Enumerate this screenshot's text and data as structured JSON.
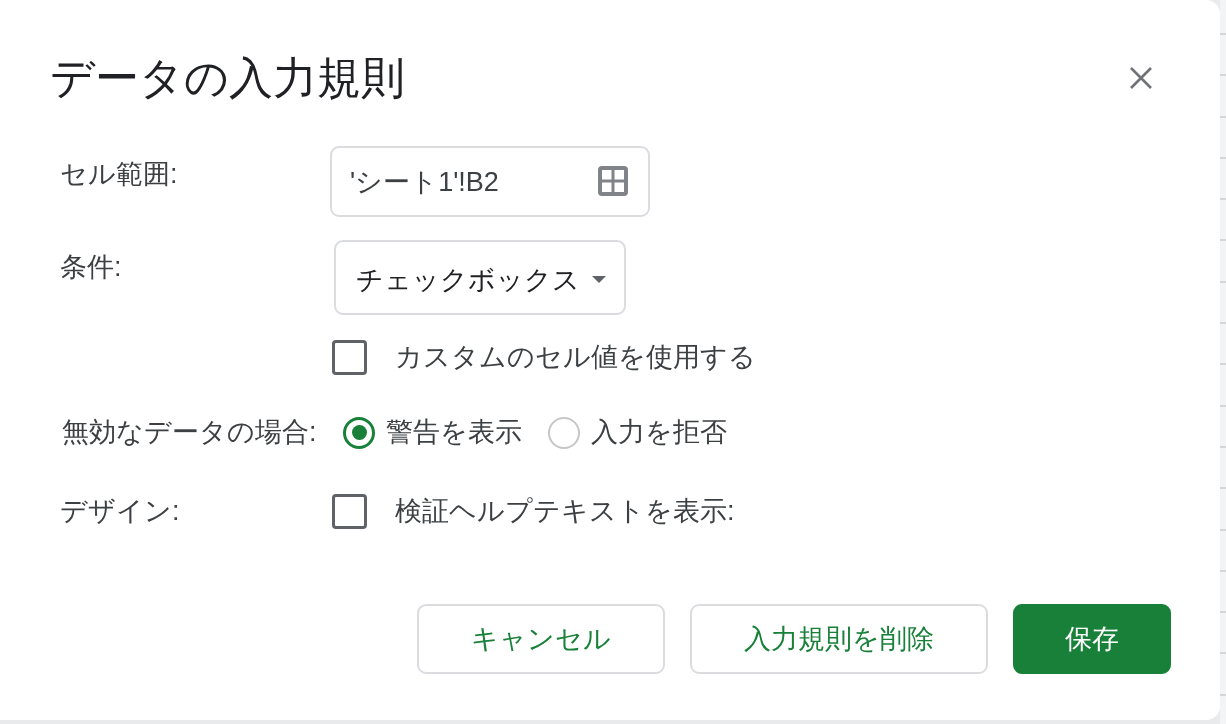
{
  "dialog": {
    "title": "データの入力規則",
    "cell_range": {
      "label": "セル範囲:",
      "value": "'シート1'!B2"
    },
    "criteria": {
      "label": "条件:",
      "value": "チェックボックス"
    },
    "custom_values": {
      "label": "カスタムのセル値を使用する",
      "checked": false
    },
    "invalid_data": {
      "label": "無効なデータの場合:",
      "options": [
        {
          "label": "警告を表示",
          "selected": true
        },
        {
          "label": "入力を拒否",
          "selected": false
        }
      ]
    },
    "appearance": {
      "label": "デザイン:",
      "help_text": {
        "label": "検証ヘルプテキストを表示:",
        "checked": false
      }
    },
    "buttons": [
      {
        "label": "キャンセル",
        "kind": "secondary"
      },
      {
        "label": "入力規則を削除",
        "kind": "secondary"
      },
      {
        "label": "保存",
        "kind": "primary"
      }
    ]
  }
}
